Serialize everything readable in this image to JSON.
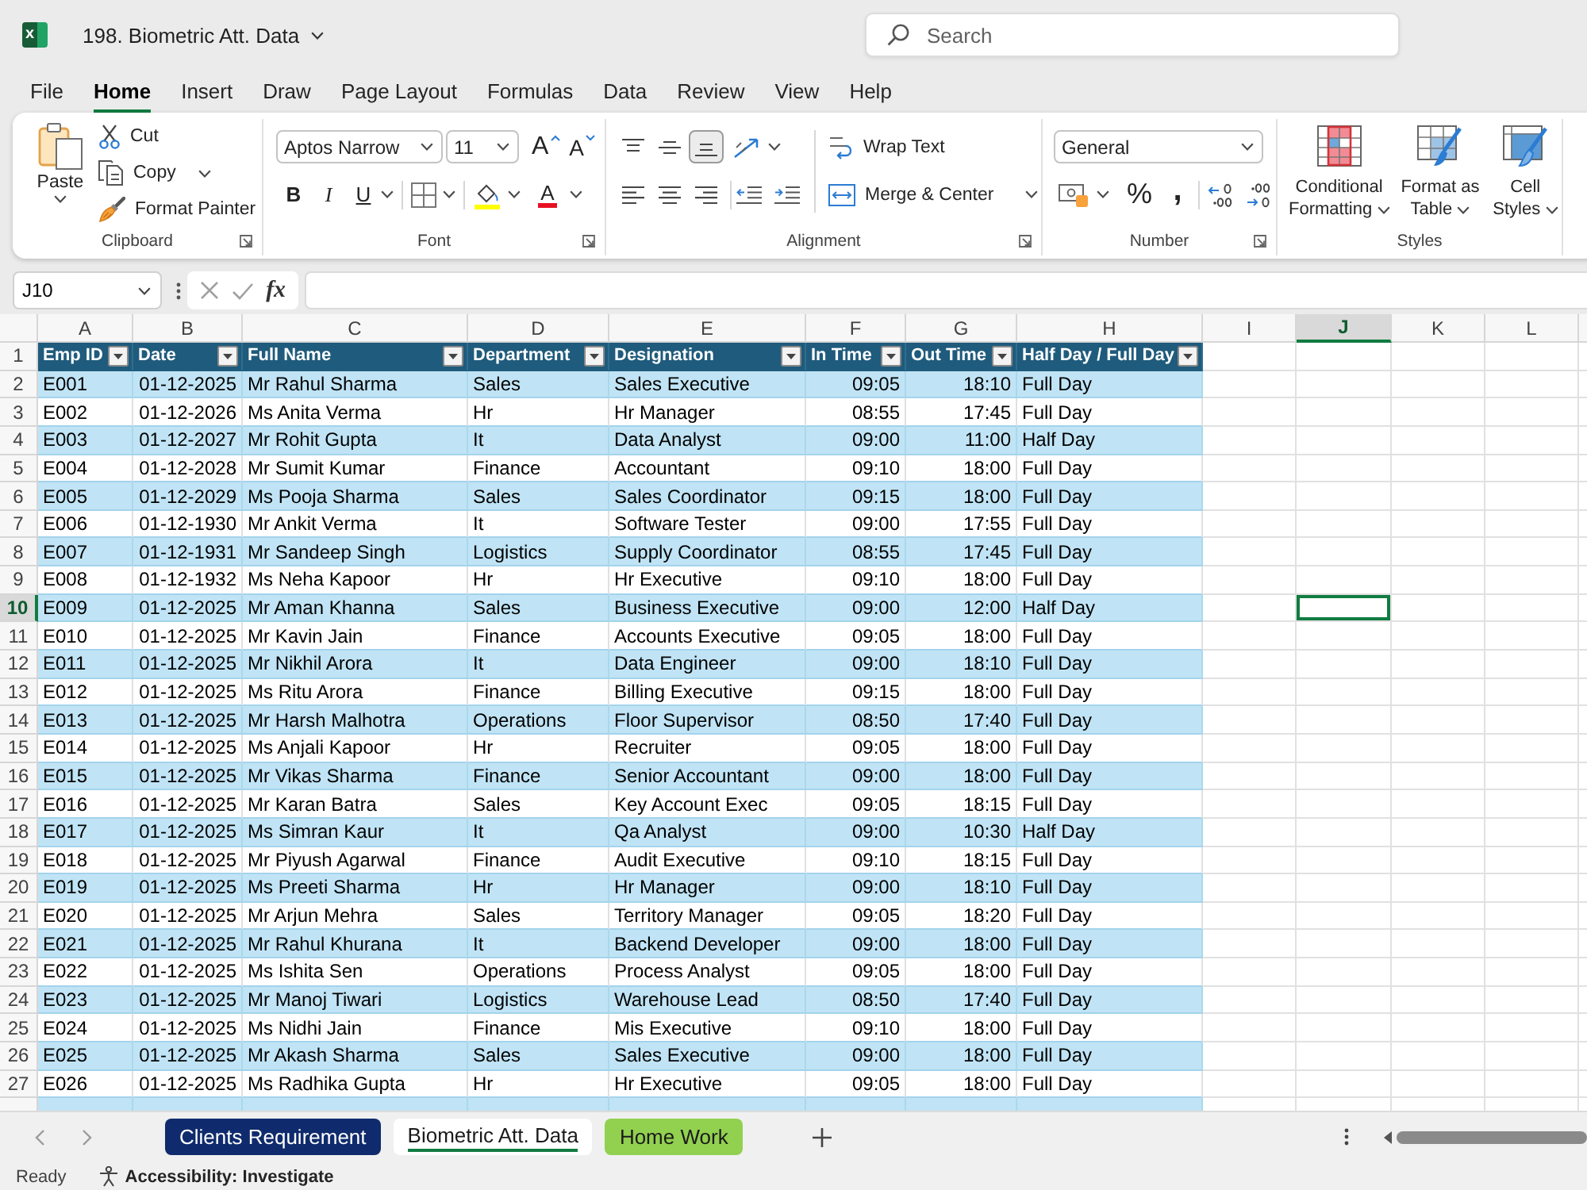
{
  "window": {
    "logo_letter": "x",
    "title": "198. Biometric Att. Data",
    "search_placeholder": "Search"
  },
  "menu_tabs": [
    {
      "label": "File",
      "selected": false
    },
    {
      "label": "Home",
      "selected": true
    },
    {
      "label": "Insert",
      "selected": false
    },
    {
      "label": "Draw",
      "selected": false
    },
    {
      "label": "Page Layout",
      "selected": false
    },
    {
      "label": "Formulas",
      "selected": false
    },
    {
      "label": "Data",
      "selected": false
    },
    {
      "label": "Review",
      "selected": false
    },
    {
      "label": "View",
      "selected": false
    },
    {
      "label": "Help",
      "selected": false
    }
  ],
  "ribbon": {
    "clipboard": {
      "label": "Clipboard",
      "paste": "Paste",
      "cut": "Cut",
      "copy": "Copy",
      "format_painter": "Format Painter"
    },
    "font": {
      "label": "Font",
      "font_name": "Aptos Narrow",
      "font_size": "11",
      "grow_font": "A",
      "shrink_font": "A",
      "bold": "B",
      "italic": "I",
      "underline": "U",
      "font_color": "A"
    },
    "alignment": {
      "label": "Alignment",
      "vertical": [
        {
          "kind": "top",
          "selected": false
        },
        {
          "kind": "middle",
          "selected": false
        },
        {
          "kind": "bottom",
          "selected": true
        }
      ],
      "horizontal": [
        {
          "kind": "left",
          "selected": false
        },
        {
          "kind": "center",
          "selected": false
        },
        {
          "kind": "right",
          "selected": false
        }
      ],
      "wrap_text": "Wrap Text",
      "merge_center": "Merge & Center"
    },
    "number": {
      "label": "Number",
      "format": "General",
      "percent": "%",
      "comma": ","
    },
    "styles": {
      "label": "Styles",
      "buttons": [
        {
          "kind": "conditional",
          "label": "Conditional Formatting"
        },
        {
          "kind": "table",
          "label": "Format as Table"
        },
        {
          "kind": "cell",
          "label": "Cell Styles"
        }
      ]
    }
  },
  "formula_bar": {
    "name_box": "J10",
    "function_label": "fx"
  },
  "sheet": {
    "columns": [
      {
        "letter": "A",
        "selected": false
      },
      {
        "letter": "B",
        "selected": false
      },
      {
        "letter": "C",
        "selected": false
      },
      {
        "letter": "D",
        "selected": false
      },
      {
        "letter": "E",
        "selected": false
      },
      {
        "letter": "F",
        "selected": false
      },
      {
        "letter": "G",
        "selected": false
      },
      {
        "letter": "H",
        "selected": false
      },
      {
        "letter": "I",
        "selected": false
      },
      {
        "letter": "J",
        "selected": true
      },
      {
        "letter": "K",
        "selected": false
      },
      {
        "letter": "L",
        "selected": false
      }
    ],
    "table": {
      "header": {
        "number": "1",
        "selected": false,
        "cells": [
          "Emp ID",
          "Date",
          "Full Name",
          "Department",
          "Designation",
          "In Time",
          "Out Time",
          "Half Day / Full Day"
        ]
      },
      "rows": [
        {
          "number": "2",
          "selected": false,
          "cells": [
            "E001",
            "01-12-2025",
            "Mr Rahul Sharma",
            "Sales",
            "Sales Executive",
            "09:05",
            "18:10",
            "Full Day"
          ]
        },
        {
          "number": "3",
          "selected": false,
          "cells": [
            "E002",
            "01-12-2026",
            "Ms Anita Verma",
            "Hr",
            "Hr Manager",
            "08:55",
            "17:45",
            "Full Day"
          ]
        },
        {
          "number": "4",
          "selected": false,
          "cells": [
            "E003",
            "01-12-2027",
            "Mr Rohit Gupta",
            "It",
            "Data Analyst",
            "09:00",
            "11:00",
            "Half Day"
          ]
        },
        {
          "number": "5",
          "selected": false,
          "cells": [
            "E004",
            "01-12-2028",
            "Mr Sumit Kumar",
            "Finance",
            "Accountant",
            "09:10",
            "18:00",
            "Full Day"
          ]
        },
        {
          "number": "6",
          "selected": false,
          "cells": [
            "E005",
            "01-12-2029",
            "Ms Pooja Sharma",
            "Sales",
            "Sales Coordinator",
            "09:15",
            "18:00",
            "Full Day"
          ]
        },
        {
          "number": "7",
          "selected": false,
          "cells": [
            "E006",
            "01-12-1930",
            "Mr Ankit Verma",
            "It",
            "Software Tester",
            "09:00",
            "17:55",
            "Full Day"
          ]
        },
        {
          "number": "8",
          "selected": false,
          "cells": [
            "E007",
            "01-12-1931",
            "Mr Sandeep Singh",
            "Logistics",
            "Supply Coordinator",
            "08:55",
            "17:45",
            "Full Day"
          ]
        },
        {
          "number": "9",
          "selected": false,
          "cells": [
            "E008",
            "01-12-1932",
            "Ms Neha Kapoor",
            "Hr",
            "Hr Executive",
            "09:10",
            "18:00",
            "Full Day"
          ]
        },
        {
          "number": "10",
          "selected": true,
          "cells": [
            "E009",
            "01-12-2025",
            "Mr Aman Khanna",
            "Sales",
            "Business Executive",
            "09:00",
            "12:00",
            "Half Day"
          ]
        },
        {
          "number": "11",
          "selected": false,
          "cells": [
            "E010",
            "01-12-2025",
            "Mr Kavin Jain",
            "Finance",
            "Accounts Executive",
            "09:05",
            "18:00",
            "Full Day"
          ]
        },
        {
          "number": "12",
          "selected": false,
          "cells": [
            "E011",
            "01-12-2025",
            "Mr Nikhil Arora",
            "It",
            "Data Engineer",
            "09:00",
            "18:10",
            "Full Day"
          ]
        },
        {
          "number": "13",
          "selected": false,
          "cells": [
            "E012",
            "01-12-2025",
            "Ms Ritu Arora",
            "Finance",
            "Billing Executive",
            "09:15",
            "18:00",
            "Full Day"
          ]
        },
        {
          "number": "14",
          "selected": false,
          "cells": [
            "E013",
            "01-12-2025",
            "Mr Harsh Malhotra",
            "Operations",
            "Floor Supervisor",
            "08:50",
            "17:40",
            "Full Day"
          ]
        },
        {
          "number": "15",
          "selected": false,
          "cells": [
            "E014",
            "01-12-2025",
            "Ms Anjali Kapoor",
            "Hr",
            "Recruiter",
            "09:05",
            "18:00",
            "Full Day"
          ]
        },
        {
          "number": "16",
          "selected": false,
          "cells": [
            "E015",
            "01-12-2025",
            "Mr Vikas Sharma",
            "Finance",
            "Senior Accountant",
            "09:00",
            "18:00",
            "Full Day"
          ]
        },
        {
          "number": "17",
          "selected": false,
          "cells": [
            "E016",
            "01-12-2025",
            "Mr Karan Batra",
            "Sales",
            "Key Account Exec",
            "09:05",
            "18:15",
            "Full Day"
          ]
        },
        {
          "number": "18",
          "selected": false,
          "cells": [
            "E017",
            "01-12-2025",
            "Ms Simran Kaur",
            "It",
            "Qa Analyst",
            "09:00",
            "10:30",
            "Half Day"
          ]
        },
        {
          "number": "19",
          "selected": false,
          "cells": [
            "E018",
            "01-12-2025",
            "Mr Piyush Agarwal",
            "Finance",
            "Audit Executive",
            "09:10",
            "18:15",
            "Full Day"
          ]
        },
        {
          "number": "20",
          "selected": false,
          "cells": [
            "E019",
            "01-12-2025",
            "Ms Preeti Sharma",
            "Hr",
            "Hr Manager",
            "09:00",
            "18:10",
            "Full Day"
          ]
        },
        {
          "number": "21",
          "selected": false,
          "cells": [
            "E020",
            "01-12-2025",
            "Mr Arjun Mehra",
            "Sales",
            "Territory Manager",
            "09:05",
            "18:20",
            "Full Day"
          ]
        },
        {
          "number": "22",
          "selected": false,
          "cells": [
            "E021",
            "01-12-2025",
            "Mr Rahul Khurana",
            "It",
            "Backend Developer",
            "09:00",
            "18:00",
            "Full Day"
          ]
        },
        {
          "number": "23",
          "selected": false,
          "cells": [
            "E022",
            "01-12-2025",
            "Ms Ishita Sen",
            "Operations",
            "Process Analyst",
            "09:05",
            "18:00",
            "Full Day"
          ]
        },
        {
          "number": "24",
          "selected": false,
          "cells": [
            "E023",
            "01-12-2025",
            "Mr Manoj Tiwari",
            "Logistics",
            "Warehouse Lead",
            "08:50",
            "17:40",
            "Full Day"
          ]
        },
        {
          "number": "25",
          "selected": false,
          "cells": [
            "E024",
            "01-12-2025",
            "Ms Nidhi Jain",
            "Finance",
            "Mis Executive",
            "09:10",
            "18:00",
            "Full Day"
          ]
        },
        {
          "number": "26",
          "selected": false,
          "cells": [
            "E025",
            "01-12-2025",
            "Mr Akash Sharma",
            "Sales",
            "Sales Executive",
            "09:00",
            "18:00",
            "Full Day"
          ]
        },
        {
          "number": "27",
          "selected": false,
          "cells": [
            "E026",
            "01-12-2025",
            "Ms Radhika Gupta",
            "Hr",
            "Hr Executive",
            "09:05",
            "18:00",
            "Full Day"
          ]
        }
      ]
    }
  },
  "sheet_tabs": [
    {
      "label": "Clients Requirement",
      "selected": false,
      "color": "#0f2b6d"
    },
    {
      "label": "Biometric Att. Data",
      "selected": true
    },
    {
      "label": "Home Work",
      "selected": false,
      "color": "#92d050"
    }
  ],
  "status_bar": {
    "mode": "Ready",
    "accessibility": "Accessibility: Investigate"
  }
}
